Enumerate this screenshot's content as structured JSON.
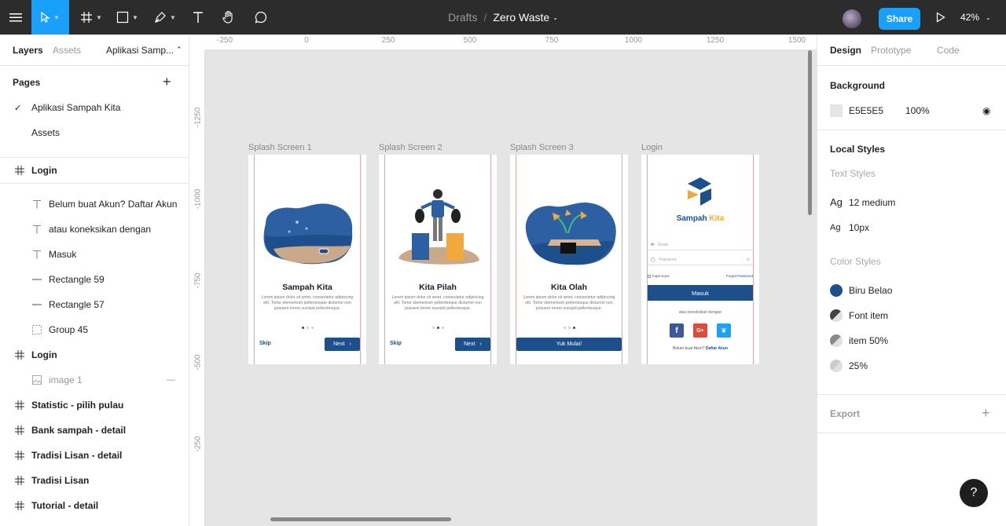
{
  "toolbar": {
    "breadcrumb_drafts": "Drafts",
    "breadcrumb_separator": "/",
    "file_name": "Zero Waste",
    "share_label": "Share",
    "zoom_label": "42%"
  },
  "left_panel": {
    "tabs": [
      "Layers",
      "Assets"
    ],
    "page_selector": "Aplikasi Samp...",
    "pages_heading": "Pages",
    "pages": [
      {
        "label": "Aplikasi Sampah Kita",
        "selected": true
      },
      {
        "label": "Assets",
        "selected": false
      }
    ],
    "layers": [
      {
        "label": "Login",
        "icon": "frame-icon",
        "bold": true
      },
      {
        "label": "Belum buat Akun? Daftar Akun",
        "icon": "text-icon"
      },
      {
        "label": "atau koneksikan dengan",
        "icon": "text-icon"
      },
      {
        "label": "Masuk",
        "icon": "text-icon"
      },
      {
        "label": "Rectangle 59",
        "icon": "line-icon"
      },
      {
        "label": "Rectangle 57",
        "icon": "line-icon"
      },
      {
        "label": "Group 45",
        "icon": "group-icon"
      },
      {
        "label": "Login",
        "icon": "frame-icon",
        "bold": true
      },
      {
        "label": "image 1",
        "icon": "image-icon",
        "hidden": true
      },
      {
        "label": "Statistic - pilih pulau",
        "icon": "frame-icon",
        "bold": true
      },
      {
        "label": "Bank sampah - detail",
        "icon": "frame-icon",
        "bold": true
      },
      {
        "label": "Tradisi Lisan - detail",
        "icon": "frame-icon",
        "bold": true
      },
      {
        "label": "Tradisi Lisan",
        "icon": "frame-icon",
        "bold": true
      },
      {
        "label": "Tutorial - detail",
        "icon": "frame-icon",
        "bold": true
      }
    ]
  },
  "canvas": {
    "ruler_x": [
      "-250",
      "0",
      "250",
      "500",
      "750",
      "1000",
      "1250",
      "1500"
    ],
    "ruler_y": [
      "-1250",
      "-1000",
      "-750",
      "-500",
      "-250"
    ],
    "frames": [
      {
        "label": "Splash Screen 1",
        "title": "Sampah Kita",
        "lorem": "Lorem ipsum dolor sit amet, consectetur adipiscing elit. Tortor elementum pellentesque dictumst non posuere lorem suscipit pellentesque.",
        "skip": "Skip",
        "next": "Next"
      },
      {
        "label": "Splash Screen 2",
        "title": "Kita Pilah",
        "lorem": "Lorem ipsum dolor sit amet, consectetur adipiscing elit. Tortor elementum pellentesque dictumst non posuere lorem suscipit pellentesque.",
        "skip": "Skip",
        "next": "Next"
      },
      {
        "label": "Splash Screen 3",
        "title": "Kita Olah",
        "lorem": "Lorem ipsum dolor sit amet, consectetur adipiscing elit. Tortor elementum pellentesque dictumst non posuere lorem suscipit pellentesque.",
        "cta": "Yuk Mulai!"
      },
      {
        "label": "Login",
        "brand_part1": "Sampah",
        "brand_part2": "Kita",
        "email_placeholder": "Email",
        "password_placeholder": "Password",
        "remember": "Ingat Saya",
        "forgot": "Forgot Password",
        "login_button": "Masuk",
        "connect_text": "atau koneksikan dengan",
        "signup_prefix": "Belum buat Akun?",
        "signup_link": "Daftar Akun"
      }
    ]
  },
  "right_panel": {
    "tabs": [
      "Design",
      "Prototype",
      "Code"
    ],
    "background_heading": "Background",
    "background_hex": "E5E5E5",
    "background_opacity": "100%",
    "local_styles_heading": "Local Styles",
    "text_styles_heading": "Text Styles",
    "text_styles": [
      {
        "sample": "Ag",
        "name": "12 medium"
      },
      {
        "sample": "Ag",
        "name": "10px"
      }
    ],
    "color_styles_heading": "Color Styles",
    "color_styles": [
      {
        "name": "Biru Belao",
        "color": "#1d4f8c"
      },
      {
        "name": "Font item",
        "color": "#444444"
      },
      {
        "name": "item 50%",
        "color": "#888888"
      },
      {
        "name": "25%",
        "color": "#cccccc"
      }
    ],
    "export_heading": "Export"
  },
  "help_label": "?"
}
